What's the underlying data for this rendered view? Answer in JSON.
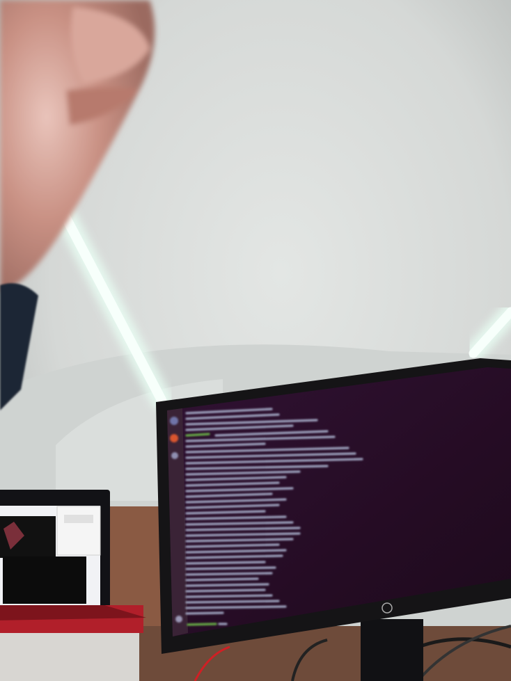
{
  "scene": {
    "description_colors": {
      "ceiling": "#d9dcda",
      "ceiling_shadow": "#b9bdbb",
      "hand": "#c99184",
      "sleeve": "#1e2634",
      "light_tube": "#f4fff9",
      "monitor_bezel": "#151416",
      "terminal_bg": "#2a0f29",
      "terminal_text": "#aeb7d3",
      "launcher_bg": "#3a2336",
      "laptop_body": "#b11f2a",
      "desk": "#8a5a43",
      "cable": "#d11f24"
    },
    "monitor": {
      "brand_logo": "hp-logo-icon",
      "screen": "terminal-window"
    },
    "laptop": {
      "screen": "desktop-windows"
    }
  }
}
